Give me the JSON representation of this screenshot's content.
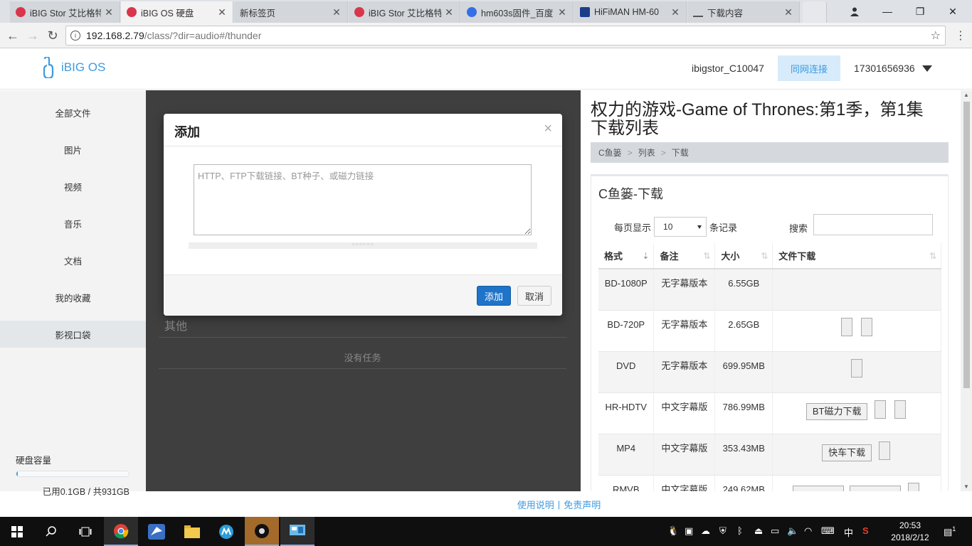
{
  "browser": {
    "tabs": [
      {
        "title": "iBIG Stor 艾比格特",
        "favicon_color": "#d9364c"
      },
      {
        "title": "iBIG OS 硬盘",
        "favicon_color": "#d9364c"
      },
      {
        "title": "新标签页",
        "favicon_color": ""
      },
      {
        "title": "iBIG Stor 艾比格特",
        "favicon_color": "#d9364c"
      },
      {
        "title": "hm603s固件_百度",
        "favicon_color": "#3370e6"
      },
      {
        "title": "HiFiMAN HM-60",
        "favicon_color": "#1a3e8a"
      },
      {
        "title": "下载内容",
        "favicon_color": ""
      }
    ],
    "url_host": "192.168.2.79",
    "url_path": "/class/?dir=audio#/thunder",
    "win_minimize": "—",
    "win_restore": "❐",
    "win_close": "✕"
  },
  "header": {
    "logo_text": "iBIG OS",
    "username": "ibigstor_C10047",
    "lan_button": "同网连接",
    "phone": "17301656936"
  },
  "sidebar": {
    "items": [
      {
        "label": "全部文件"
      },
      {
        "label": "图片"
      },
      {
        "label": "视频"
      },
      {
        "label": "音乐"
      },
      {
        "label": "文档"
      },
      {
        "label": "我的收藏"
      },
      {
        "label": "影视口袋"
      }
    ],
    "disk_label": "硬盘容量",
    "disk_usage": "已用0.1GB / 共931GB",
    "disk_fraction": 0.0001
  },
  "background": {
    "other_label": "其他",
    "no_tasks": "没有任务"
  },
  "modal": {
    "title": "添加",
    "close": "×",
    "placeholder": "HTTP、FTP下载链接、BT种子、或磁力链接",
    "resize_hint": "^^^^^^",
    "add_button": "添加",
    "cancel_button": "取消"
  },
  "right": {
    "title_line1": "权力的游戏-Game of Thrones:第1季，第1集",
    "title_line2": "下载列表",
    "breadcrumb": [
      "C鱼篓",
      "列表",
      "下载"
    ],
    "breadcrumb_sep": ">",
    "panel_title": "C鱼篓-下载",
    "per_page_prefix": "每页显示",
    "per_page_value": "10",
    "per_page_suffix": "条记录",
    "search_label": "搜索",
    "columns": [
      "格式",
      "备注",
      "大小",
      "文件下载"
    ],
    "rows": [
      {
        "format": "BD-1080P",
        "note": "无字幕版本",
        "size": "6.55GB"
      },
      {
        "format": "BD-720P",
        "note": "无字幕版本",
        "size": "2.65GB"
      },
      {
        "format": "DVD",
        "note": "无字幕版本",
        "size": "699.95MB"
      },
      {
        "format": "HR-HDTV",
        "note": "中文字幕版",
        "size": "786.99MB",
        "button": "BT磁力下载"
      },
      {
        "format": "MP4",
        "note": "中文字幕版",
        "size": "353.43MB",
        "button": "快车下载"
      },
      {
        "format": "RMVB",
        "note": "中文字幕版",
        "size": "249.62MB"
      }
    ]
  },
  "footer": {
    "manual": "使用说明",
    "separator": "|",
    "disclaimer": "免责声明"
  },
  "taskbar": {
    "ime": "中",
    "time": "20:53",
    "date": "2018/2/12",
    "notification_count": "1"
  }
}
